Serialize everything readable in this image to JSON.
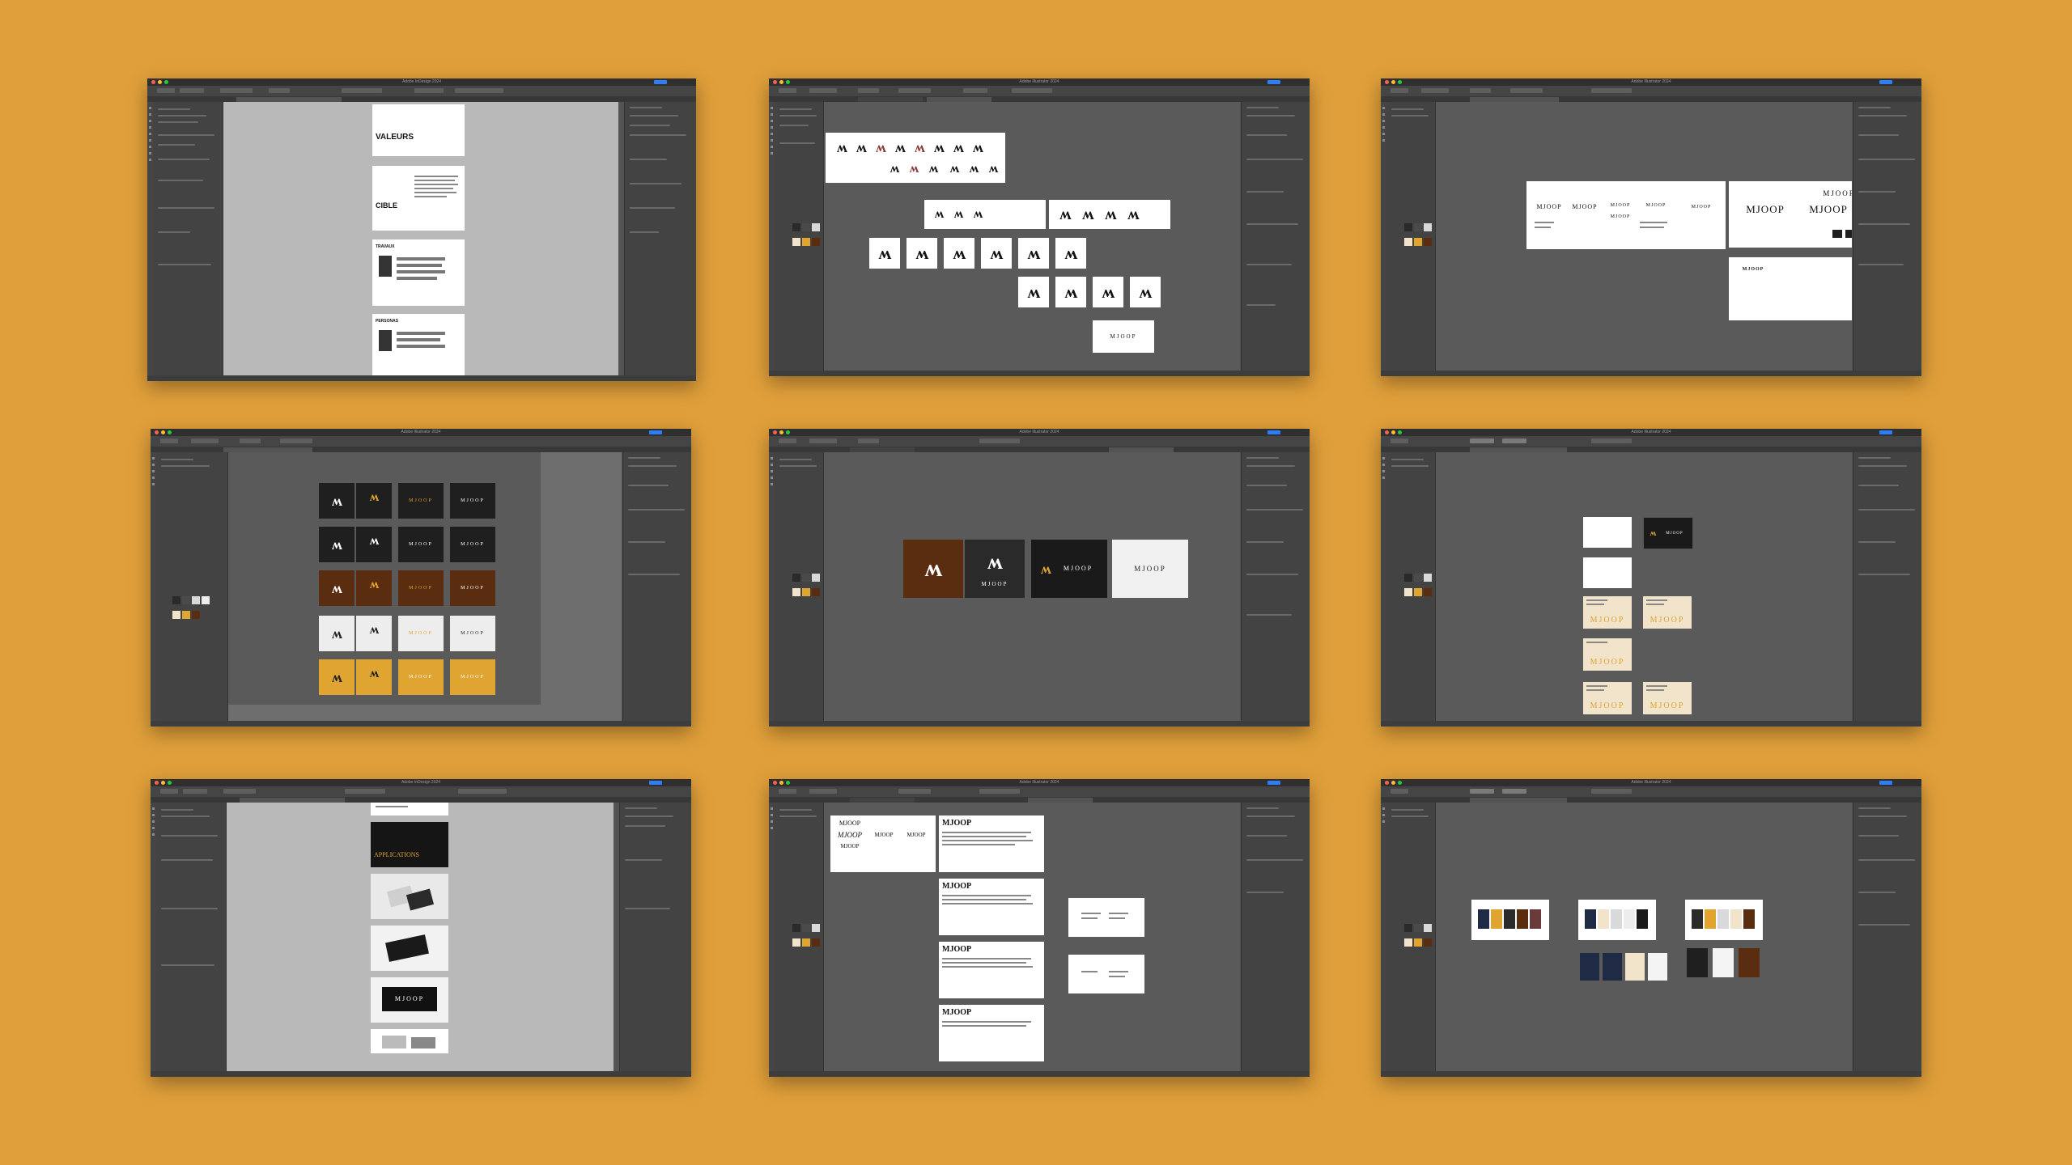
{
  "app": {
    "illustrator_title": "Adobe Illustrator 2024",
    "indesign_title": "Adobe InDesign 2024",
    "monogram": "ʍ",
    "logo_wordmark": "MJOOP"
  },
  "colors": {
    "background": "#E09F3A",
    "window": "#535353",
    "brand_dark": "#1f1f1f",
    "brand_gold": "#E0A431",
    "brand_brown": "#5A2D10",
    "brand_cream": "#F1E4CB"
  },
  "swatches": [
    "#2a2a2a",
    "#4a4a4a",
    "#d9d9d9",
    "#ededed",
    "#F1E4CB",
    "#E0A431",
    "#5A2D10"
  ],
  "indesign_pages_1": {
    "page_titles": [
      "VALEURS",
      "CIBLE",
      "TRAVAUX",
      "PERSONAS"
    ]
  },
  "indesign_pages_2": {
    "page_titles": [
      "APPLICATIONS",
      "MJOOP"
    ]
  },
  "typo_board": {
    "heading": "MJOOP"
  },
  "icons": [
    "share-button",
    "close-icon",
    "minimize-icon",
    "zoom-icon"
  ]
}
